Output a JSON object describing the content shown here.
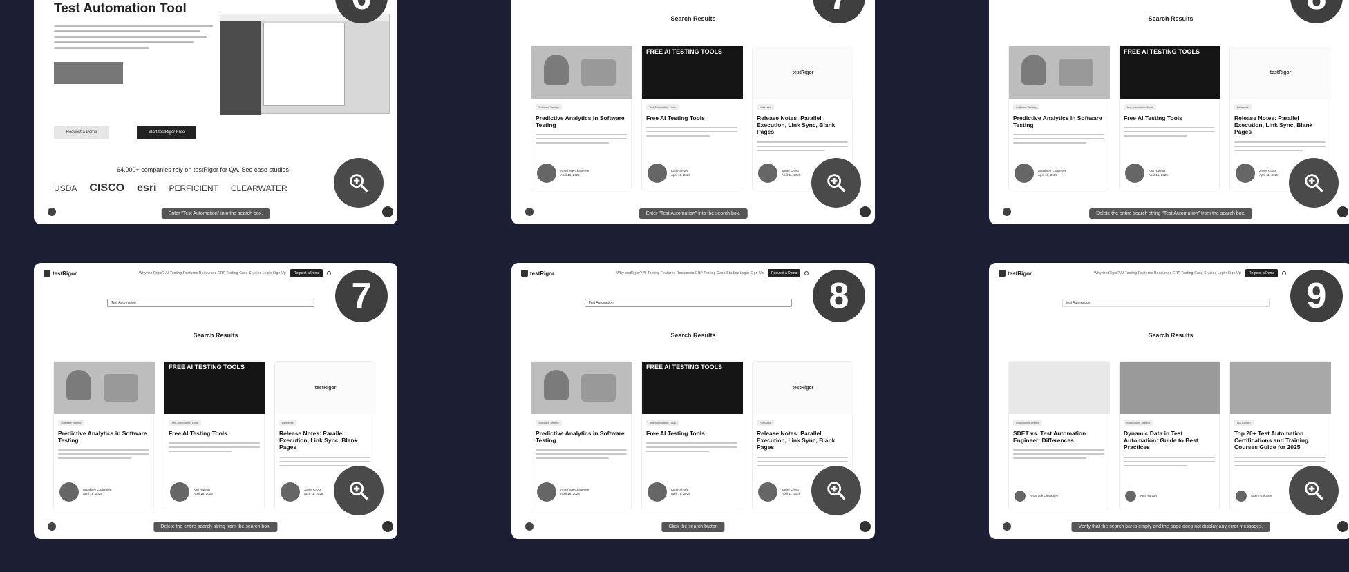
{
  "panels": [
    {
      "step": "6",
      "title": "Test Automation Tool",
      "cta_secondary": "Request a Demo",
      "cta_primary": "Start testRigor Free",
      "companies_line": "64,000+ companies rely on testRigor for QA. See case studies",
      "logos": [
        "USDA",
        "CISCO",
        "esri",
        "PERFICIENT",
        "CLEARWATER"
      ],
      "caption": "Enter \"Test Automation\" into the search box."
    },
    {
      "step": "7",
      "results_title": "Search Results",
      "caption": "Enter \"Test Automation\" into the search box."
    },
    {
      "step": "8",
      "results_title": "Search Results",
      "caption": "Delete the entire search string \"Test Automation\" from the search box."
    },
    {
      "step": "7",
      "search_value": "Test Automation",
      "results_title": "Search Results",
      "caption": "Delete the entire search string from the search box."
    },
    {
      "step": "8",
      "search_value": "Test Automation",
      "results_title": "Search Results",
      "caption": "Click the search button"
    },
    {
      "step": "9",
      "search_value": "test Automation",
      "results_title": "Search Results",
      "caption": "Verify that the search bar is empty and the page does not display any error messages."
    }
  ],
  "nav": {
    "logo": "testRigor",
    "links": "Why testRigor?   AI Testing   Features   Resources   ERP Testing   Case Studies   Login   Sign Up",
    "request": "Request a Demo"
  },
  "cards_set_a": [
    {
      "tag": "Software Testing",
      "title": "Predictive Analytics in Software Testing",
      "author": "Anushree Chatterjee",
      "date": "April 16, 2025"
    },
    {
      "tag": "Test Automation Tools",
      "title": "Free AI Testing Tools",
      "author": "Kari Rahrah",
      "date": "April 15, 2025",
      "img_text": "FREE AI TESTING TOOLS"
    },
    {
      "tag": "Releases",
      "title": "Release Notes: Parallel Execution, Link Sync, Blank Pages",
      "author": "Javier Cross",
      "date": "April 11, 2025",
      "img_text": "testRigor"
    }
  ],
  "cards_set_b": [
    {
      "tag": "Automation Testing",
      "title": "SDET vs. Test Automation Engineer: Differences",
      "author": "Anushree Chatterjee",
      "date": ""
    },
    {
      "tag": "Automation Testing",
      "title": "Dynamic Data in Test Automation: Guide to Best Practices",
      "author": "Kari Rahrah",
      "date": ""
    },
    {
      "tag": "QA Growth",
      "title": "Top 20+ Test Automation Certifications and Training Courses Guide for 2025",
      "author": "Artem Golubev",
      "date": ""
    }
  ]
}
